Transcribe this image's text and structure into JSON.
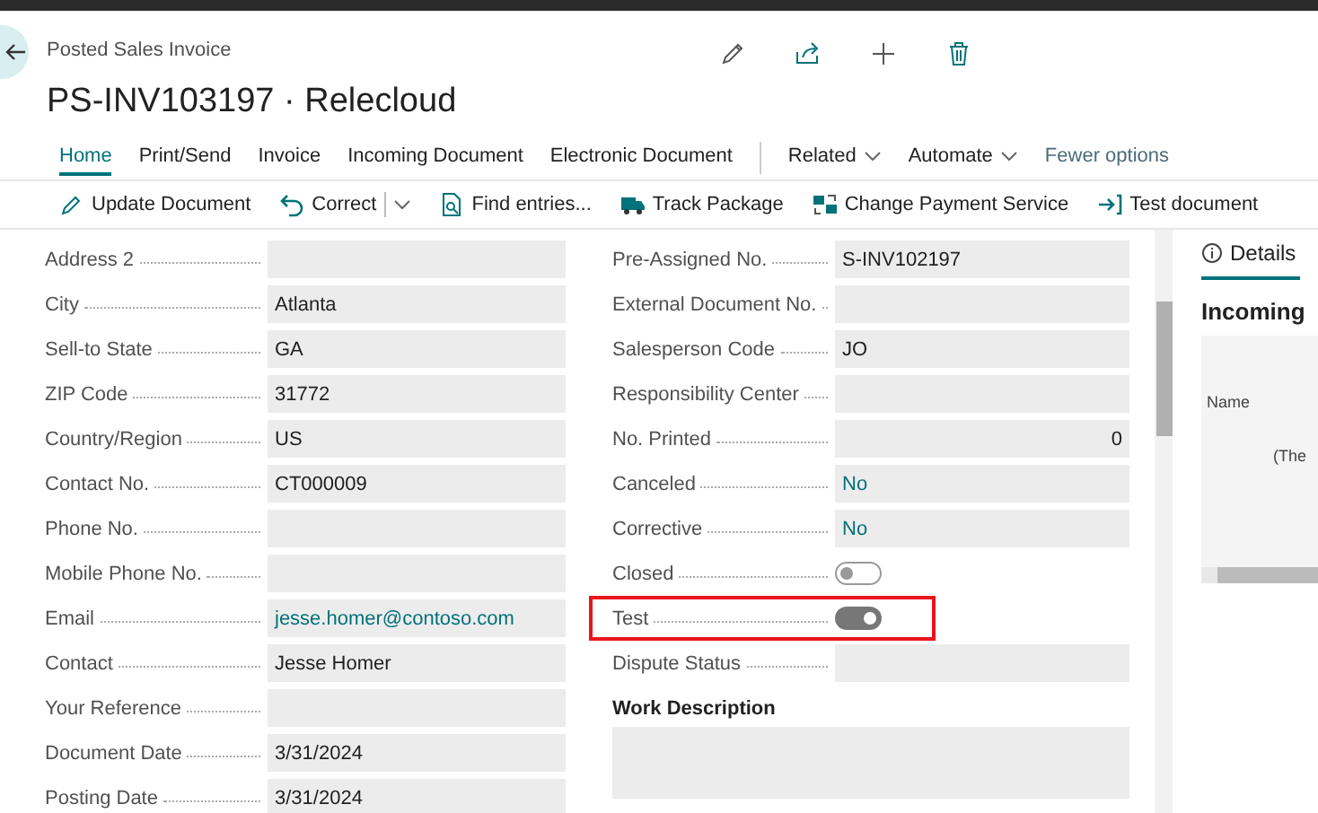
{
  "header": {
    "caption": "Posted Sales Invoice",
    "title": "PS-INV103197 · Relecloud"
  },
  "tabs": [
    {
      "label": "Home",
      "selected": true,
      "kind": "tab"
    },
    {
      "label": "Print/Send",
      "selected": false,
      "kind": "tab"
    },
    {
      "label": "Invoice",
      "selected": false,
      "kind": "tab"
    },
    {
      "label": "Incoming Document",
      "selected": false,
      "kind": "tab"
    },
    {
      "label": "Electronic Document",
      "selected": false,
      "kind": "tab"
    },
    {
      "label": "Related",
      "selected": false,
      "kind": "menu"
    },
    {
      "label": "Automate",
      "selected": false,
      "kind": "menu"
    },
    {
      "label": "Fewer options",
      "selected": false,
      "kind": "link"
    }
  ],
  "actions": [
    {
      "label": "Update Document",
      "kind": "button"
    },
    {
      "label": "Correct",
      "kind": "split"
    },
    {
      "label": "Find entries...",
      "kind": "button"
    },
    {
      "label": "Track Package",
      "kind": "button"
    },
    {
      "label": "Change Payment Service",
      "kind": "button"
    },
    {
      "label": "Test document",
      "kind": "button"
    }
  ],
  "left_fields": [
    {
      "label": "Address 2",
      "kind": "text"
    },
    {
      "label": "City",
      "value": "Atlanta",
      "kind": "text"
    },
    {
      "label": "Sell-to State",
      "value": "GA",
      "kind": "text"
    },
    {
      "label": "ZIP Code",
      "value": "31772",
      "kind": "text"
    },
    {
      "label": "Country/Region",
      "value": "US",
      "kind": "text"
    },
    {
      "label": "Contact No.",
      "value": "CT000009",
      "kind": "text"
    },
    {
      "label": "Phone No.",
      "kind": "text"
    },
    {
      "label": "Mobile Phone No.",
      "kind": "text"
    },
    {
      "label": "Email",
      "value": "jesse.homer@contoso.com",
      "kind": "link"
    },
    {
      "label": "Contact",
      "value": "Jesse Homer",
      "kind": "text"
    },
    {
      "label": "Your Reference",
      "kind": "text"
    },
    {
      "label": "Document Date",
      "value": "3/31/2024",
      "kind": "text"
    },
    {
      "label": "Posting Date",
      "value": "3/31/2024",
      "kind": "text"
    }
  ],
  "right_fields": [
    {
      "label": "Pre-Assigned No.",
      "value": "S-INV102197",
      "kind": "text"
    },
    {
      "label": "External Document No.",
      "kind": "text"
    },
    {
      "label": "Salesperson Code",
      "value": "JO",
      "kind": "text"
    },
    {
      "label": "Responsibility Center",
      "kind": "text"
    },
    {
      "label": "No. Printed",
      "value": "0",
      "kind": "number"
    },
    {
      "label": "Canceled",
      "value": "No",
      "kind": "link"
    },
    {
      "label": "Corrective",
      "value": "No",
      "kind": "link"
    },
    {
      "label": "Closed",
      "on": false,
      "kind": "toggle",
      "highlighted": false
    },
    {
      "label": "Test",
      "on": true,
      "kind": "toggle",
      "highlighted": true
    },
    {
      "label": "Dispute Status",
      "kind": "text"
    }
  ],
  "work_description": {
    "heading": "Work Description"
  },
  "details": {
    "tab": "Details",
    "heading": "Incoming",
    "column": "Name",
    "note": "(The"
  }
}
